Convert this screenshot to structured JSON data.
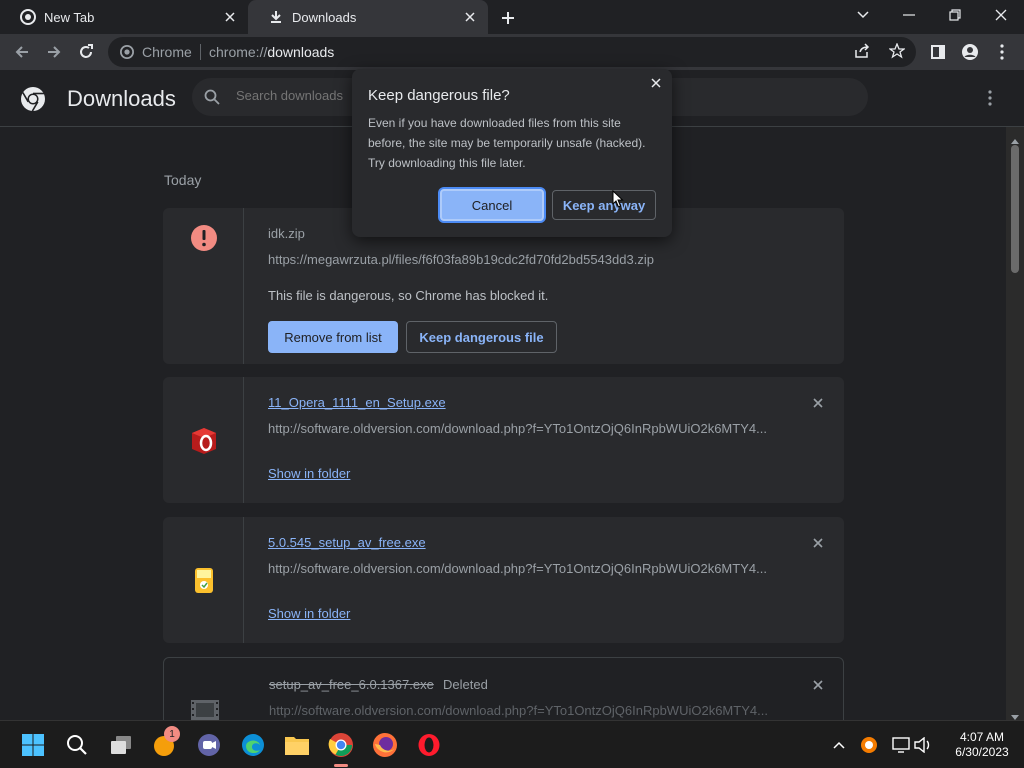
{
  "tabs": [
    {
      "title": "New Tab",
      "icon": "chrome-icon"
    },
    {
      "title": "Downloads",
      "icon": "download-icon",
      "active": true
    }
  ],
  "omnibox": {
    "chip": "Chrome",
    "url_scheme": "chrome://",
    "url_path": "downloads"
  },
  "header": {
    "title": "Downloads",
    "search_placeholder": "Search downloads"
  },
  "content": {
    "date_heading": "Today"
  },
  "downloads": [
    {
      "filename": "idk.zip",
      "url": "https://megawrzuta.pl/files/f6f03fa89b19cdc2fd70fd2bd5543dd3.zip",
      "status": "This file is dangerous, so Chrome has blocked it.",
      "buttons": [
        "Remove from list",
        "Keep dangerous file"
      ],
      "icon": "danger-icon"
    },
    {
      "filename": "11_Opera_1111_en_Setup.exe",
      "url": "http://software.oldversion.com/download.php?f=YTo1OntzOjQ6InRpbWUiO2k6MTY4...",
      "action": "Show in folder",
      "icon": "opera-installer-icon"
    },
    {
      "filename": "5.0.545_setup_av_free.exe",
      "url": "http://software.oldversion.com/download.php?f=YTo1OntzOjQ6InRpbWUiO2k6MTY4...",
      "action": "Show in folder",
      "icon": "avfree-installer-icon"
    },
    {
      "filename": "setup_av_free_6.0.1367.exe",
      "tag": "Deleted",
      "url": "http://software.oldversion.com/download.php?f=YTo1OntzOjQ6InRpbWUiO2k6MTY4...",
      "icon": "file-icon"
    }
  ],
  "dialog": {
    "title": "Keep dangerous file?",
    "body": "Even if you have downloaded files from this site before, the site may be temporarily unsafe (hacked). Try downloading this file later.",
    "cancel": "Cancel",
    "keep": "Keep anyway"
  },
  "taskbar": {
    "time": "4:07 AM",
    "date": "6/30/2023",
    "badge_count": "1"
  },
  "colors": {
    "accent": "#8ab4f8",
    "danger": "#f28b82",
    "background": "#202124",
    "surface": "#292a2d"
  }
}
